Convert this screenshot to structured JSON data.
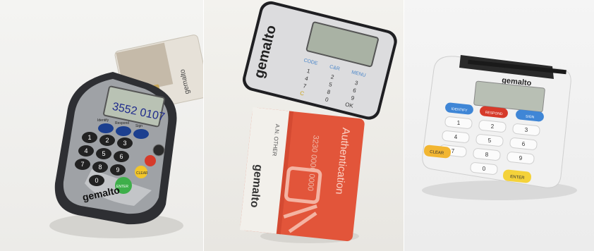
{
  "panels": [
    {
      "brand": "gemalto",
      "display": "3552 0107",
      "top_keys": [
        "Identify",
        "Respond",
        "Sign"
      ],
      "keys": [
        "1",
        "2",
        "3",
        "4",
        "5",
        "6",
        "7",
        "8",
        "9",
        "0"
      ],
      "func_keys": [
        "CLEAR",
        "ENTER"
      ],
      "card_brand": "gemalto"
    },
    {
      "brand": "gemalto",
      "top_keys": [
        "CODE",
        "C&R",
        "MENU"
      ],
      "keys": [
        "1",
        "2",
        "3",
        "4",
        "5",
        "6",
        "7",
        "8",
        "9",
        "0"
      ],
      "bottom_left": "C",
      "bottom_right": "OK",
      "card_title": "Authentication",
      "card_brand": "gemalto",
      "card_number": "3230 0000 0000",
      "card_name": "A.N. OTHER"
    },
    {
      "brand": "gemalto",
      "top_keys": [
        "IDENTIFY",
        "RESPOND",
        "SIGN"
      ],
      "keys": [
        "1",
        "2",
        "3",
        "4",
        "5",
        "6",
        "7",
        "8",
        "9",
        "0"
      ],
      "func_keys": [
        "CLEAR",
        "ENTER"
      ]
    }
  ],
  "colors": {
    "lcd": "#b9c2b4",
    "blue_key": "#3f86d6",
    "red_key": "#d63a2a",
    "yellow_key": "#f2c62a",
    "green_key": "#3eaf4a",
    "card_orange": "#e2553a"
  }
}
